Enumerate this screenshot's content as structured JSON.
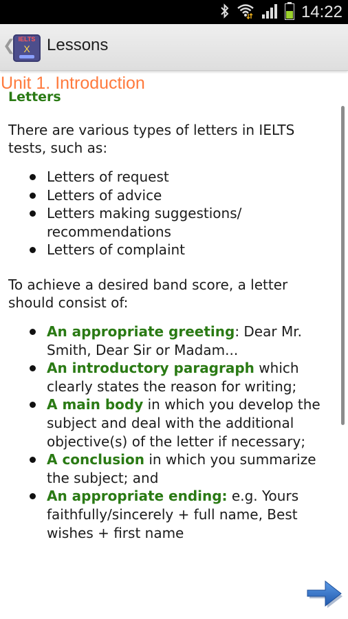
{
  "status_bar": {
    "time": "14:22"
  },
  "action_bar": {
    "title": "Lessons",
    "back_glyph": "❮",
    "app_icon_top": "IELTS",
    "app_icon_mid": "X"
  },
  "unit": {
    "title": "Unit 1. Introduction"
  },
  "lesson": {
    "section_title": "Letters",
    "intro": "There are various types of letters in IELTS tests, such as:",
    "types": [
      "Letters of request",
      "Letters of advice",
      "Letters making suggestions/ recommendations",
      "Letters of complaint"
    ],
    "band_intro": "To achieve a desired band score, a letter should consist of:",
    "components": [
      {
        "term": "An appropriate greeting",
        "text": ": Dear Mr. Smith, Dear Sir or Madam..."
      },
      {
        "term": "An introductory paragraph",
        "text": " which clearly states the reason for writing;"
      },
      {
        "term": "A main body",
        "text": " in which you develop the subject and deal with the additional objective(s) of the letter if necessary;"
      },
      {
        "term": "A conclusion",
        "text": " in which you summarize the subject; and"
      },
      {
        "term": "An appropriate ending:",
        "text": " e.g. Yours faithfully/sincerely + full name, Best wishes + first name"
      }
    ]
  },
  "icons": {
    "bluetooth": "bluetooth-icon",
    "wifi": "wifi-icon",
    "signal": "signal-icon",
    "battery": "battery-icon",
    "next": "next-arrow-icon"
  },
  "colors": {
    "accent_orange": "#ff7a3d",
    "term_green": "#2a7a14",
    "arrow_blue": "#2d6bc2"
  }
}
